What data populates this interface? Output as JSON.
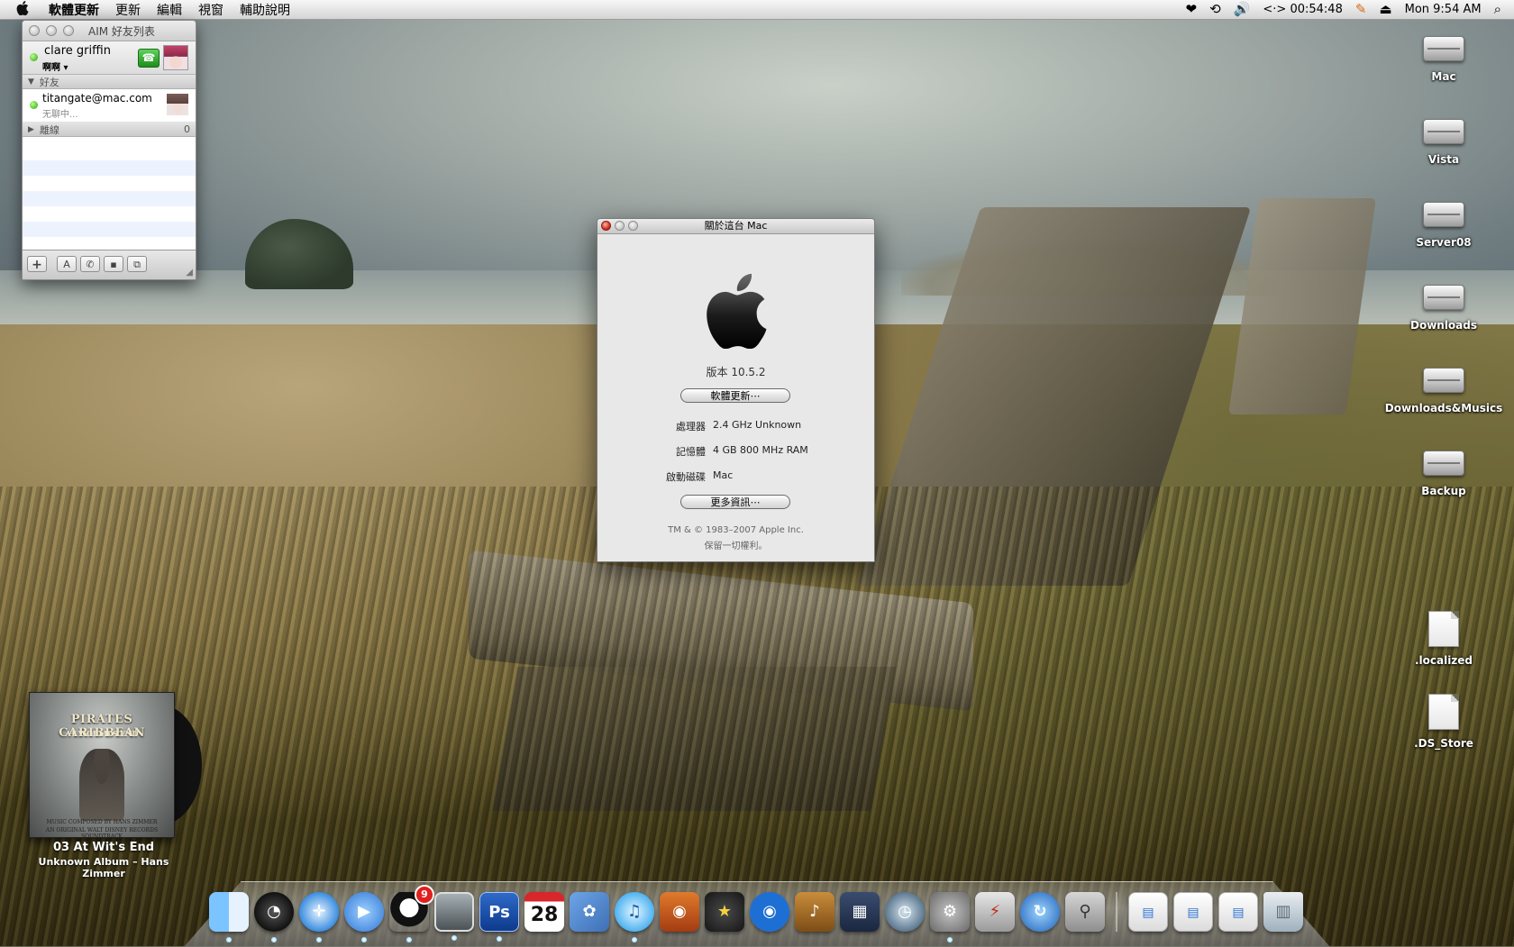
{
  "menubar": {
    "items": [
      "軟體更新",
      "更新",
      "編輯",
      "視窗",
      "輔助說明"
    ],
    "timer": "00:54:48",
    "clock": "Mon 9:54 AM"
  },
  "aim": {
    "title": "AIM 好友列表",
    "me": {
      "name": "clare griffin",
      "status": "啊啊"
    },
    "group_buddies": "好友",
    "buddy": {
      "name": "titangate@mac.com",
      "status": "无聊中..."
    },
    "group_offline": "離線",
    "offline_count": "0",
    "toolbar": {
      "add": "+",
      "text": "A"
    }
  },
  "about": {
    "title": "關於這台 Mac",
    "version": "版本 10.5.2",
    "update_button": "軟體更新⋯",
    "rows": [
      {
        "key": "處理器",
        "value": "2.4 GHz Unknown"
      },
      {
        "key": "記憶體",
        "value": "4 GB 800 MHz RAM"
      },
      {
        "key": "啟動磁碟",
        "value": "Mac"
      }
    ],
    "more_button": "更多資訊⋯",
    "copyright": "TM & © 1983–2007 Apple Inc.",
    "rights": "保留一切權利。"
  },
  "desktop_icons": [
    "Mac",
    "Vista",
    "Server08",
    "Downloads",
    "Downloads&Musics",
    "Backup",
    ".localized",
    ".DS_Store"
  ],
  "itunes": {
    "album_title": "PIRATES CARIBBEAN",
    "album_subtitle": "AT WORLD'S END",
    "album_credit1": "MUSIC COMPOSED BY HANS ZIMMER",
    "album_credit2": "AN ORIGINAL WALT DISNEY RECORDS SOUNDTRACK",
    "track": "03 At Wit's End",
    "artist": "Unknown Album – Hans Zimmer"
  },
  "dock": {
    "photoshop_label": "Ps",
    "calendar_day": "28",
    "qq_badge": "9"
  }
}
